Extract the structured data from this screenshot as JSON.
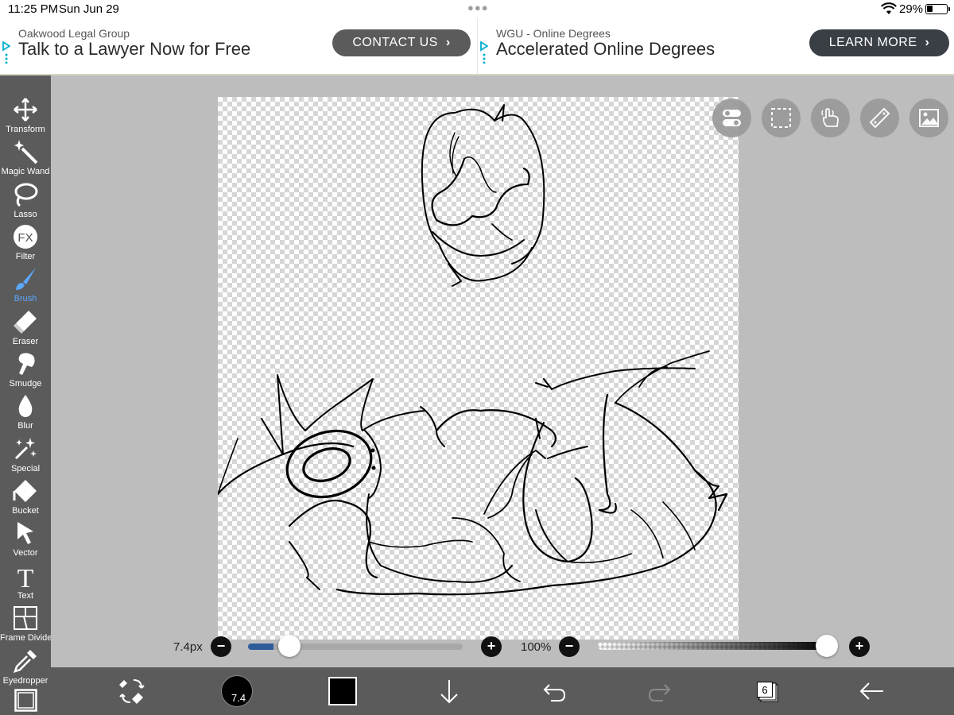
{
  "status": {
    "time": "11:25 PM",
    "date": "Sun Jun 29",
    "battery_pct": "29%",
    "battery_level": 0.29
  },
  "ads": [
    {
      "sponsor": "Oakwood Legal Group",
      "headline": "Talk to a Lawyer Now for Free",
      "cta": "CONTACT US"
    },
    {
      "sponsor": "WGU - Online Degrees",
      "headline": "Accelerated Online Degrees",
      "cta": "LEARN MORE"
    }
  ],
  "tools": [
    {
      "label": "Transform",
      "icon": "transform-icon"
    },
    {
      "label": "Magic Wand",
      "icon": "magic-wand-icon"
    },
    {
      "label": "Lasso",
      "icon": "lasso-icon"
    },
    {
      "label": "Filter",
      "icon": "fx-icon"
    },
    {
      "label": "Brush",
      "icon": "brush-icon",
      "active": true
    },
    {
      "label": "Eraser",
      "icon": "eraser-icon"
    },
    {
      "label": "Smudge",
      "icon": "smudge-icon"
    },
    {
      "label": "Blur",
      "icon": "blur-drop-icon"
    },
    {
      "label": "Special",
      "icon": "sparkle-icon"
    },
    {
      "label": "Bucket",
      "icon": "bucket-icon"
    },
    {
      "label": "Vector",
      "icon": "vector-arrow-icon"
    },
    {
      "label": "Text",
      "icon": "text-icon"
    },
    {
      "label": "Frame Divider",
      "icon": "frame-divider-icon"
    },
    {
      "label": "Eyedropper",
      "icon": "eyedropper-icon"
    }
  ],
  "fx_glyph": "FX",
  "text_glyph": "T",
  "floating_buttons": [
    "toggle-icon",
    "selection-icon",
    "hand-icon",
    "ruler-icon",
    "image-icon"
  ],
  "brush": {
    "size_label": "7.4px",
    "size_value": "7.4",
    "size_fraction": 0.12,
    "opacity_label": "100%",
    "opacity_fraction": 1.0,
    "minus": "−",
    "plus": "+"
  },
  "bottom": {
    "color": "#000000",
    "layer_count": "6"
  },
  "colors": {
    "toolbar_bg": "#5b5b5b",
    "accent": "#5aa8ff",
    "slider_fill": "#2e5c9a"
  }
}
